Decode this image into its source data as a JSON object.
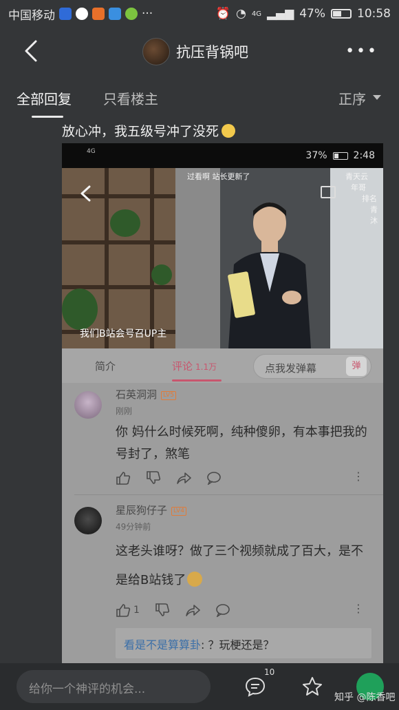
{
  "status_bar": {
    "carrier": "中国移动",
    "signal_label": "4G",
    "battery": "47%",
    "battery_level": 0.47,
    "time": "10:58"
  },
  "header": {
    "title": "抗压背锅吧"
  },
  "tabs": {
    "all": "全部回复",
    "owner_only": "只看楼主",
    "order": "正序"
  },
  "post": {
    "text": "放心冲，我五级号冲了没死"
  },
  "screenshot": {
    "status": {
      "network": "4G",
      "battery": "37%",
      "battery_level": 0.37,
      "time": "2:48"
    },
    "video": {
      "caption": "我们B站会号召UP主",
      "danmaku": [
        "过看啊 站长更新了",
        "青天云",
        "年哥",
        "排名",
        "青沐"
      ]
    },
    "tabs": {
      "intro": "简介",
      "comments": "评论",
      "comments_count": "1.1万",
      "danmaku_placeholder": "点我发弹幕",
      "danmaku_icon": "弹"
    },
    "comments": [
      {
        "user": "石英洞洞",
        "level": "LV5",
        "time": "刚刚",
        "text": "你 妈什么时候死啊，纯种傻卵，有本事把我的号封了，煞笔",
        "likes": ""
      },
      {
        "user": "星辰狗仔子",
        "level": "LV4",
        "time": "49分钟前",
        "text": "这老头谁呀？做了三个视频就成了百大，是不是给B站钱了",
        "likes": "1"
      }
    ],
    "reply": {
      "link": "看是不是算算卦",
      "text": ": ？玩梗还是？"
    }
  },
  "bottom_bar": {
    "input_placeholder": "给你一个神评的机会...",
    "comment_count": "10",
    "watermark": "知乎 @陈香吧"
  },
  "icons": {
    "back": "back-chevron-icon",
    "more": "more-dots-icon",
    "comment": "comment-icon",
    "star": "star-icon",
    "like": "thumb-up-icon",
    "dislike": "thumb-down-icon",
    "share": "share-icon",
    "reply": "reply-bubble-icon"
  },
  "colors": {
    "background": "#343638",
    "accent_pink": "#c8566e",
    "link_blue": "#3b6fa8",
    "fab_green": "#1fa05a"
  }
}
